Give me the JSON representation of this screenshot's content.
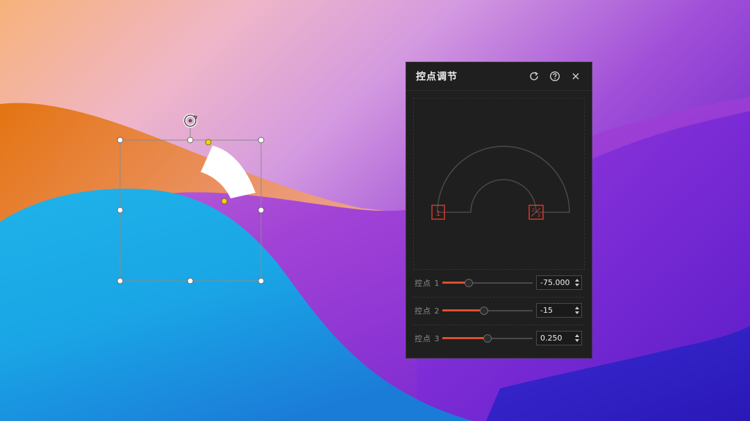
{
  "panel": {
    "title": "控点调节",
    "icons": {
      "refresh": "refresh-icon",
      "help": "help-icon",
      "close": "close-icon"
    },
    "preview_markers": {
      "marker1": "1",
      "marker2": "2",
      "marker3": "3"
    },
    "controls": [
      {
        "label": "控点 1",
        "value": "-75.000",
        "slider_fraction": 0.29
      },
      {
        "label": "控点 2",
        "value": "-15",
        "slider_fraction": 0.46
      },
      {
        "label": "控点 3",
        "value": "0.250",
        "slider_fraction": 0.5
      }
    ]
  },
  "colors": {
    "accent": "#e0502f",
    "marker": "#d9392e",
    "adjust_handle": "#f2d20f",
    "panel_bg": "#1f1f1f"
  }
}
